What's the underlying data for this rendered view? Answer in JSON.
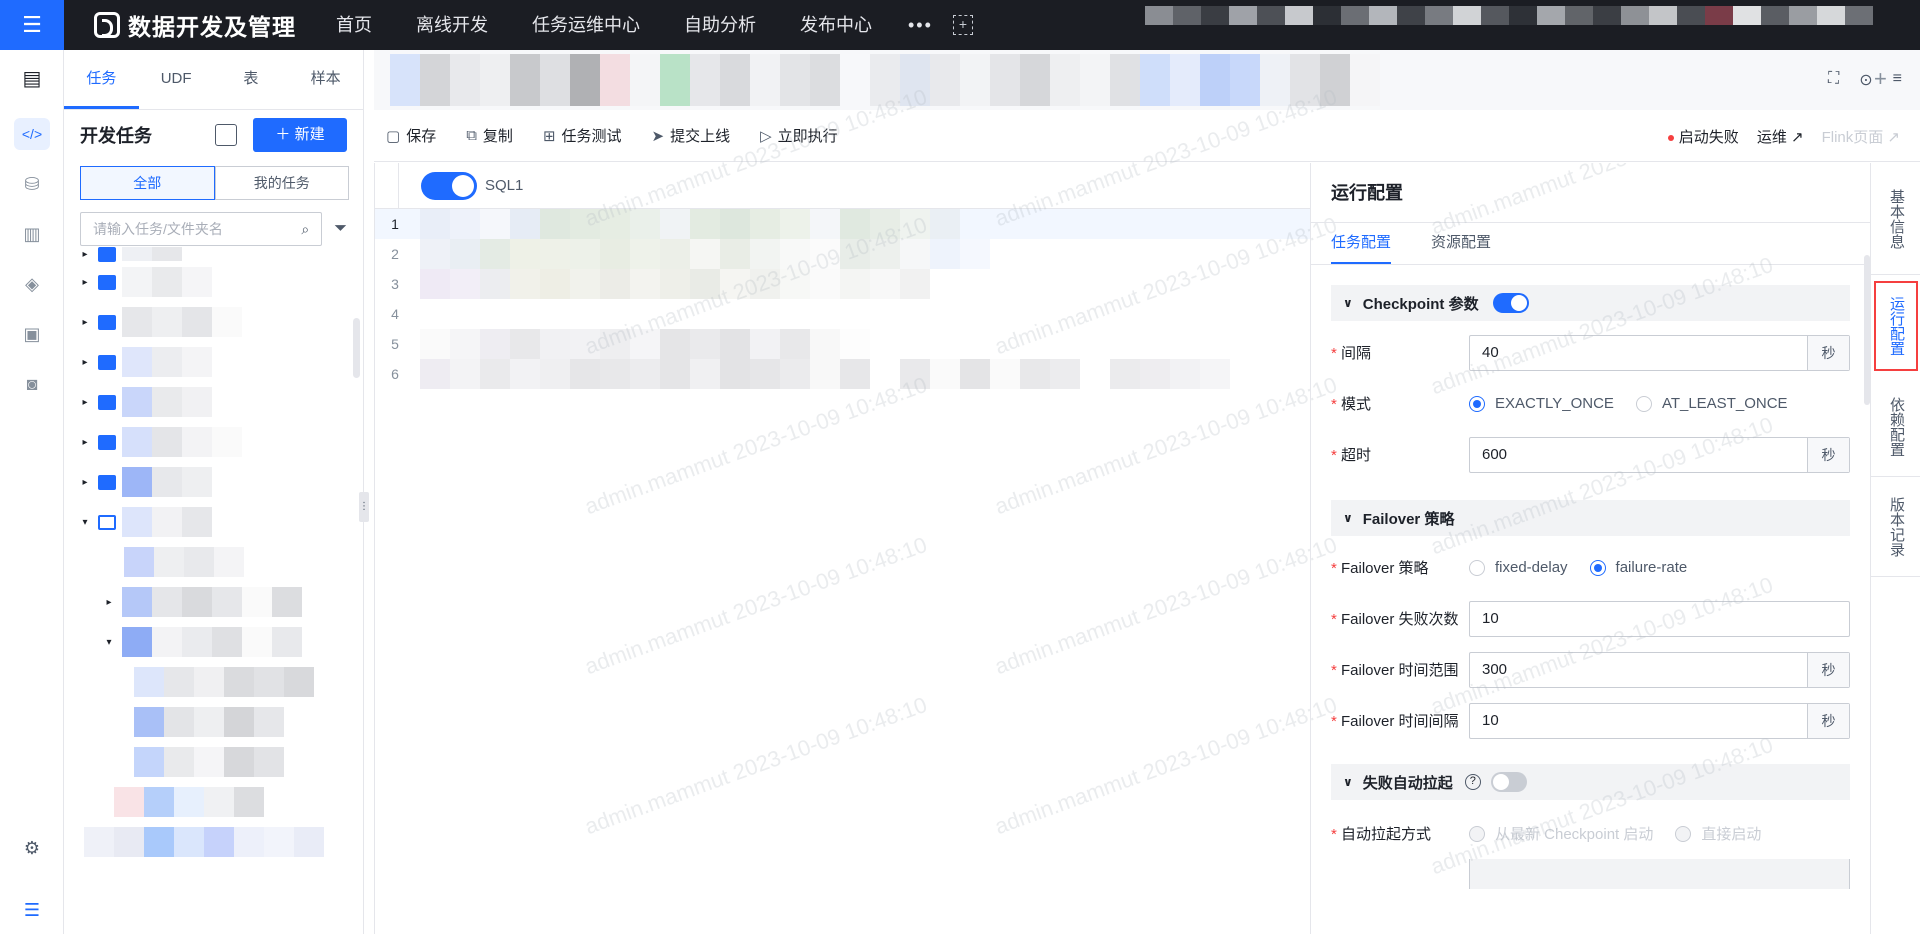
{
  "app": {
    "brand": "数据开发及管理",
    "nav": [
      "首页",
      "离线开发",
      "任务运维中心",
      "自助分析",
      "发布中心"
    ],
    "nav_more": "•••"
  },
  "sidepanel": {
    "tabs": [
      "任务",
      "UDF",
      "表",
      "样本"
    ],
    "title": "开发任务",
    "new_button": "新建",
    "segments": [
      "全部",
      "我的任务"
    ],
    "search_placeholder": "请输入任务/文件夹名"
  },
  "toolbar": {
    "save": "保存",
    "copy": "复制",
    "test": "任务测试",
    "submit": "提交上线",
    "run": "立即执行",
    "status": "启动失败",
    "ops": "运维",
    "flink": "Flink页面"
  },
  "editor": {
    "sql_label": "SQL1",
    "line_numbers": [
      "1",
      "2",
      "3",
      "4",
      "5",
      "6"
    ],
    "watermark": "admin.mammut 2023-10-09 10:48:10"
  },
  "config": {
    "title": "运行配置",
    "tabs": [
      "任务配置",
      "资源配置"
    ],
    "checkpoint": {
      "section": "Checkpoint 参数",
      "interval_label": "间隔",
      "interval_value": "40",
      "unit": "秒",
      "mode_label": "模式",
      "mode_options": [
        "EXACTLY_ONCE",
        "AT_LEAST_ONCE"
      ],
      "timeout_label": "超时",
      "timeout_value": "600"
    },
    "failover": {
      "section": "Failover 策略",
      "strategy_label": "Failover 策略",
      "strategy_options": [
        "fixed-delay",
        "failure-rate"
      ],
      "fail_count_label": "Failover 失败次数",
      "fail_count_value": "10",
      "time_range_label": "Failover 时间范围",
      "time_range_value": "300",
      "time_interval_label": "Failover 时间间隔",
      "time_interval_value": "10"
    },
    "auto_restart": {
      "section": "失败自动拉起",
      "help": "?",
      "method_label": "自动拉起方式",
      "method_options": [
        "从最新 Checkpoint 启动",
        "直接启动"
      ]
    }
  },
  "rightrail": [
    "基本信息",
    "运行配置",
    "依赖配置",
    "版本记录"
  ]
}
